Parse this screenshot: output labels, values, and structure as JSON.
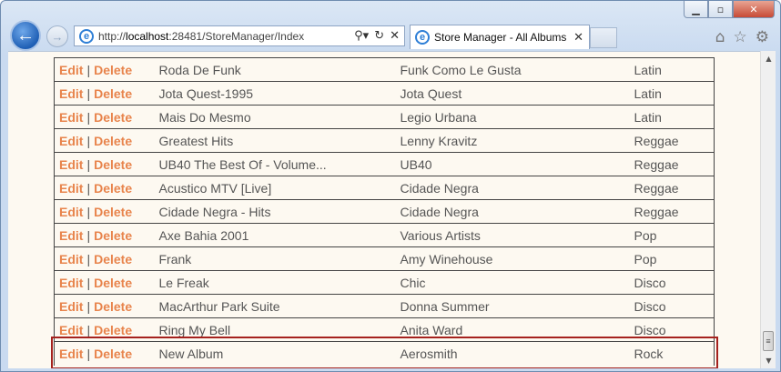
{
  "browser": {
    "url_prefix": "http://",
    "url_host": "localhost",
    "url_rest": ":28481/StoreManager/Index",
    "tab_title": "Store Manager - All Albums",
    "back_glyph": "←",
    "forward_glyph": "→",
    "search_glyph": "⚲▾",
    "refresh_glyph": "↻",
    "stop_glyph": "✕",
    "tab_close_glyph": "✕",
    "home_glyph": "⌂",
    "favorites_glyph": "☆",
    "tools_glyph": "⚙",
    "minimize_glyph": "▁",
    "maximize_glyph": "▫",
    "close_glyph": "✕",
    "scroll_up_glyph": "▲",
    "scroll_down_glyph": "▼",
    "scroll_thumb_glyph": "≡"
  },
  "actions": {
    "edit": "Edit",
    "separator": "|",
    "delete": "Delete"
  },
  "albums": [
    {
      "title": "Roda De Funk",
      "artist": "Funk Como Le Gusta",
      "genre": "Latin"
    },
    {
      "title": "Jota Quest-1995",
      "artist": "Jota Quest",
      "genre": "Latin"
    },
    {
      "title": "Mais Do Mesmo",
      "artist": "Legio Urbana",
      "genre": "Latin"
    },
    {
      "title": "Greatest Hits",
      "artist": "Lenny Kravitz",
      "genre": "Reggae"
    },
    {
      "title": "UB40 The Best Of - Volume...",
      "artist": "UB40",
      "genre": "Reggae"
    },
    {
      "title": "Acustico MTV [Live]",
      "artist": "Cidade Negra",
      "genre": "Reggae"
    },
    {
      "title": "Cidade Negra - Hits",
      "artist": "Cidade Negra",
      "genre": "Reggae"
    },
    {
      "title": "Axe Bahia 2001",
      "artist": "Various Artists",
      "genre": "Pop"
    },
    {
      "title": "Frank",
      "artist": "Amy Winehouse",
      "genre": "Pop"
    },
    {
      "title": "Le Freak",
      "artist": "Chic",
      "genre": "Disco"
    },
    {
      "title": "MacArthur Park Suite",
      "artist": "Donna Summer",
      "genre": "Disco"
    },
    {
      "title": "Ring My Bell",
      "artist": "Anita Ward",
      "genre": "Disco"
    },
    {
      "title": "New Album",
      "artist": "Aerosmith",
      "genre": "Rock"
    }
  ]
}
